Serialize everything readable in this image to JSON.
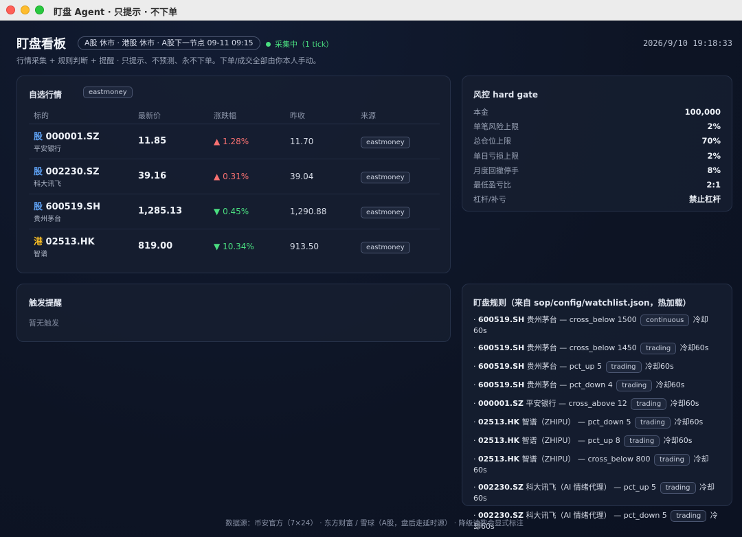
{
  "window": {
    "title": "盯盘 Agent · 只提示 · 不下单"
  },
  "header": {
    "title": "盯盘看板",
    "market_status": "A股 休市 · 港股 休市 · A股下一节点 09-11 09:15",
    "collect_status": "采集中（1 tick）",
    "datetime": "2026/9/10 19:18:33",
    "subtitle": "行情采集 + 规则判断 + 提醒 · 只提示、不预测、永不下单。下单/成交全部由你本人手动。"
  },
  "colors": {
    "up": "#f87171",
    "down": "#4ade80",
    "status_green": "#4ade80",
    "a_share": "#60a5fa",
    "hk": "#fbbf24"
  },
  "watchlist": {
    "title": "自选行情",
    "source_tag": "eastmoney",
    "columns": [
      "标的",
      "最新价",
      "涨跌幅",
      "昨收",
      "来源"
    ],
    "rows": [
      {
        "market": "股",
        "market_type": "a",
        "symbol": "000001.SZ",
        "name": "平安银行",
        "price": "11.85",
        "direction": "up",
        "arrow": "▲",
        "change": "1.28%",
        "prev_close": "11.70",
        "source": "eastmoney"
      },
      {
        "market": "股",
        "market_type": "a",
        "symbol": "002230.SZ",
        "name": "科大讯飞",
        "price": "39.16",
        "direction": "up",
        "arrow": "▲",
        "change": "0.31%",
        "prev_close": "39.04",
        "source": "eastmoney"
      },
      {
        "market": "股",
        "market_type": "a",
        "symbol": "600519.SH",
        "name": "贵州茅台",
        "price": "1,285.13",
        "direction": "down",
        "arrow": "▼",
        "change": "0.45%",
        "prev_close": "1,290.88",
        "source": "eastmoney"
      },
      {
        "market": "港",
        "market_type": "hk",
        "symbol": "02513.HK",
        "name": "智谱",
        "price": "819.00",
        "direction": "down",
        "arrow": "▼",
        "change": "10.34%",
        "prev_close": "913.50",
        "source": "eastmoney"
      }
    ]
  },
  "risk": {
    "title": "风控 hard gate",
    "items": [
      {
        "label": "本金",
        "value": "100,000"
      },
      {
        "label": "单笔风险上限",
        "value": "2%"
      },
      {
        "label": "总仓位上限",
        "value": "70%"
      },
      {
        "label": "单日亏损上限",
        "value": "2%"
      },
      {
        "label": "月度回撤停手",
        "value": "8%"
      },
      {
        "label": "最低盈亏比",
        "value": "2:1"
      },
      {
        "label": "杠杆/补亏",
        "value": "禁止杠杆"
      }
    ]
  },
  "alerts": {
    "title": "触发提醒",
    "empty_text": "暂无触发"
  },
  "rules": {
    "title": "盯盘规则（来自 sop/config/watchlist.json，热加载）",
    "items": [
      {
        "code": "600519.SH",
        "name": "贵州茅台",
        "rule": "cross_below 1500",
        "tag": "continuous",
        "cooldown": "冷却60s"
      },
      {
        "code": "600519.SH",
        "name": "贵州茅台",
        "rule": "cross_below 1450",
        "tag": "trading",
        "cooldown": "冷却60s"
      },
      {
        "code": "600519.SH",
        "name": "贵州茅台",
        "rule": "pct_up 5",
        "tag": "trading",
        "cooldown": "冷却60s"
      },
      {
        "code": "600519.SH",
        "name": "贵州茅台",
        "rule": "pct_down 4",
        "tag": "trading",
        "cooldown": "冷却60s"
      },
      {
        "code": "000001.SZ",
        "name": "平安银行",
        "rule": "cross_above 12",
        "tag": "trading",
        "cooldown": "冷却60s"
      },
      {
        "code": "02513.HK",
        "name": "智谱（ZHIPU）",
        "rule": "pct_down 5",
        "tag": "trading",
        "cooldown": "冷却60s"
      },
      {
        "code": "02513.HK",
        "name": "智谱（ZHIPU）",
        "rule": "pct_up 8",
        "tag": "trading",
        "cooldown": "冷却60s"
      },
      {
        "code": "02513.HK",
        "name": "智谱（ZHIPU）",
        "rule": "cross_below 800",
        "tag": "trading",
        "cooldown": "冷却60s"
      },
      {
        "code": "002230.SZ",
        "name": "科大讯飞（AI 情绪代理）",
        "rule": "pct_up 5",
        "tag": "trading",
        "cooldown": "冷却60s"
      },
      {
        "code": "002230.SZ",
        "name": "科大讯飞（AI 情绪代理）",
        "rule": "pct_down 5",
        "tag": "trading",
        "cooldown": "冷却60s"
      }
    ]
  },
  "footer": {
    "text": "数据源：币安官方（7×24） · 东方财富 / 雪球（A股，盘后走延时源） · 降级读数会显式标注"
  }
}
